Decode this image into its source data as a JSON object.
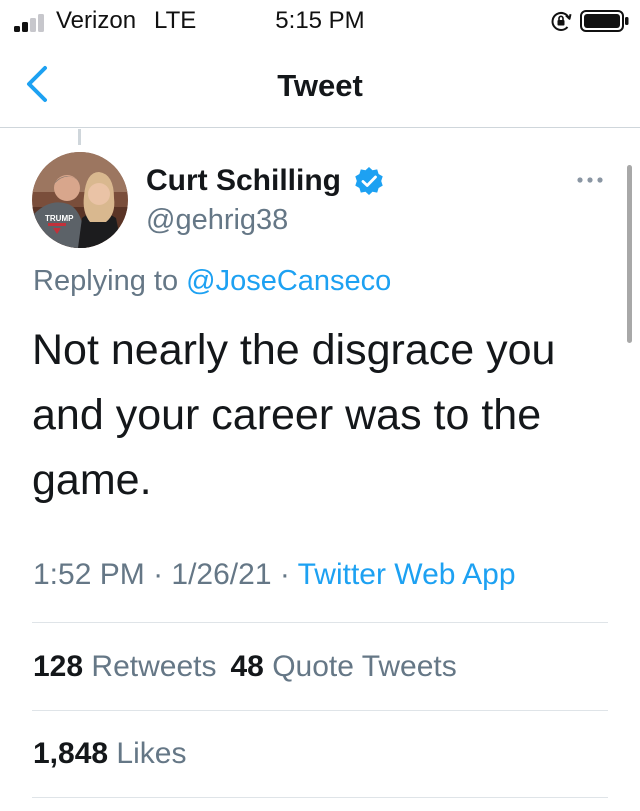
{
  "status_bar": {
    "carrier": "Verizon",
    "network": "LTE",
    "time": "5:15 PM",
    "icons": [
      "signal-bars-icon",
      "orientation-lock-icon",
      "battery-icon"
    ]
  },
  "nav": {
    "title": "Tweet",
    "back_icon": "chevron-left-icon"
  },
  "tweet": {
    "author_name": "Curt Schilling",
    "author_handle": "@gehrig38",
    "verified_icon": "verified-badge-icon",
    "more_icon": "more-dots-icon",
    "reply_prefix": "Replying to ",
    "reply_to": "@JoseCanseco",
    "text": "Not nearly the disgrace you and your career was to the game.",
    "time": "1:52 PM",
    "date": "1/26/21",
    "separator": " · ",
    "source": "Twitter Web App"
  },
  "stats": {
    "retweets_count": "128",
    "retweets_label": "Retweets",
    "quote_count": "48",
    "quote_label": "Quote Tweets",
    "likes_count": "1,848",
    "likes_label": "Likes"
  },
  "colors": {
    "accent": "#1da1f2",
    "secondary_text": "#657786",
    "primary_text": "#14171a",
    "divider": "#dfe4e8"
  }
}
